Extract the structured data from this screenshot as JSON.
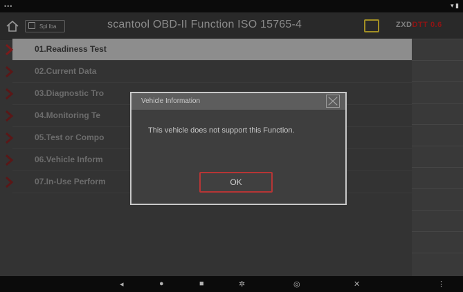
{
  "statusbar": {
    "left_indicator": "•••",
    "right_indicator": "▾ ▮"
  },
  "header": {
    "badge_text": "Spl lba",
    "title": "scantool OBD-II Function   ISO 15765-4",
    "brand_main": "ZXD",
    "brand_accent": "DTT 0.6"
  },
  "menu": {
    "items": [
      {
        "label": "01.Readiness Test",
        "active": true
      },
      {
        "label": "02.Current Data"
      },
      {
        "label": "03.Diagnostic Tro"
      },
      {
        "label": "04.Monitoring Te"
      },
      {
        "label": "05.Test or Compo"
      },
      {
        "label": "06.Vehicle Inform"
      },
      {
        "label": "07.In-Use Perform"
      }
    ]
  },
  "dialog": {
    "title": "Vehicle Information",
    "message": "This vehicle does not support this Function.",
    "ok_label": "OK"
  },
  "navbar": {
    "back": "◂",
    "home": "●",
    "recents": "■",
    "settings": "✲",
    "screenshot": "◎",
    "close": "✕",
    "menu": "⋮"
  },
  "colors": {
    "accent_red": "#b73535",
    "folder_gold": "#a28f24",
    "active_row": "#8d8d8d"
  },
  "icons": [
    "home-icon",
    "badge-icon",
    "folder-icon",
    "close-icon",
    "chevron-right-icon"
  ]
}
